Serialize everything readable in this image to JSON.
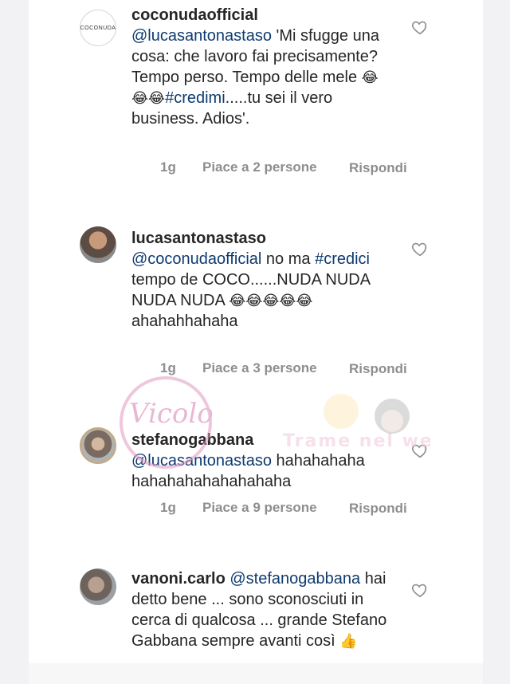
{
  "comments": [
    {
      "username": "coconudaofficial",
      "avatar_text": "COCONUDA",
      "mention": "@lucasantonastaso",
      "text_after_mention": " 'Mi sfugge una cosa: che lavoro fai precisamente? Tempo perso. Tempo delle mele ",
      "emojis_a": "😂",
      "emojis_b": "😂😂",
      "hashtag": "#credimi",
      "text_end": ".....tu sei il vero business. Adios'.",
      "time": "1g",
      "likes": "Piace a 2 persone",
      "reply": "Rispondi"
    },
    {
      "username": "lucasantonastaso",
      "mention": "@coconudaofficial",
      "text_1": " no ma ",
      "hashtag": "#credici",
      "text_2": " tempo de COCO......NUDA NUDA NUDA NUDA ",
      "emojis": "😂😂😂😂😂",
      "text_3": " ahahahhahaha",
      "time": "1g",
      "likes": "Piace a 3 persone",
      "reply": "Rispondi"
    },
    {
      "username": "stefanogabbana",
      "mention": "@lucasantonastaso",
      "text": " hahahahaha hahahahahahahahaha",
      "time": "1g",
      "likes": "Piace a 9 persone",
      "reply": "Rispondi"
    },
    {
      "username": "vanoni.carlo",
      "mention": "@stefanogabbana",
      "text": " hai detto bene ... sono sconosciuti in cerca di qualcosa ... grande Stefano Gabbana sempre avanti così ",
      "emojis": "👍"
    }
  ],
  "watermark": {
    "script_text": "Vicolo",
    "banner_text": "Trame nel web"
  },
  "colors": {
    "mention": "#0f3b70",
    "meta": "#8e8e8e",
    "text": "#262626"
  }
}
